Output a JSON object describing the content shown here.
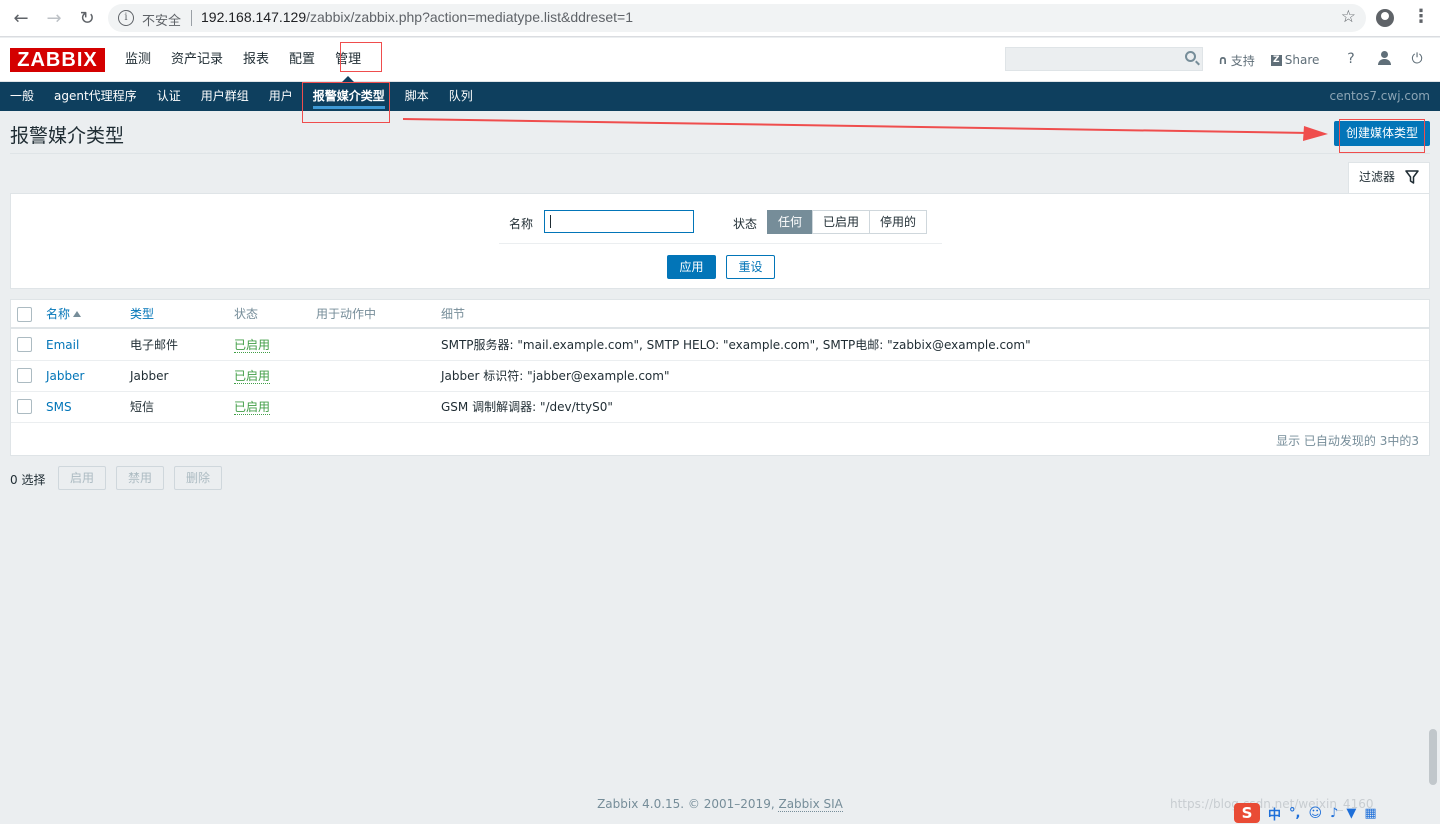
{
  "browser": {
    "insecure_label": "不安全",
    "url_host": "192.168.147.129",
    "url_path": "/zabbix/zabbix.php?action=mediatype.list&ddreset=1"
  },
  "app": {
    "logo": "ZABBIX",
    "main_menu": [
      "监测",
      "资产记录",
      "报表",
      "配置",
      "管理"
    ],
    "active_main": "管理",
    "top_links": {
      "support": "支持",
      "share": "Share",
      "help": "?"
    },
    "sub_menu": [
      "一般",
      "agent代理程序",
      "认证",
      "用户群组",
      "用户",
      "报警媒介类型",
      "脚本",
      "队列"
    ],
    "active_sub": "报警媒介类型",
    "hostname": "centos7.cwj.com"
  },
  "page": {
    "title": "报警媒介类型",
    "create_button": "创建媒体类型"
  },
  "filter": {
    "tab_label": "过滤器",
    "name_label": "名称",
    "name_value": "",
    "status_label": "状态",
    "status_options": [
      "任何",
      "已启用",
      "停用的"
    ],
    "status_selected": "任何",
    "apply": "应用",
    "reset": "重设"
  },
  "table": {
    "headers": {
      "name": "名称",
      "type": "类型",
      "status": "状态",
      "used_in": "用于动作中",
      "details": "细节"
    },
    "rows": [
      {
        "name": "Email",
        "type": "电子邮件",
        "status": "已启用",
        "used_in": "",
        "details": "SMTP服务器: \"mail.example.com\", SMTP HELO: \"example.com\", SMTP电邮: \"zabbix@example.com\""
      },
      {
        "name": "Jabber",
        "type": "Jabber",
        "status": "已启用",
        "used_in": "",
        "details": "Jabber 标识符: \"jabber@example.com\""
      },
      {
        "name": "SMS",
        "type": "短信",
        "status": "已启用",
        "used_in": "",
        "details": "GSM 调制解调器: \"/dev/ttyS0\""
      }
    ],
    "footer": "显示 已自动发现的 3中的3"
  },
  "actions": {
    "selected": "0 选择",
    "enable": "启用",
    "disable": "禁用",
    "delete": "删除"
  },
  "footer": {
    "copyright": "Zabbix 4.0.15. © 2001–2019,",
    "company": "Zabbix SIA",
    "watermark": "https://blog.csdn.net/weixin_4160"
  },
  "ime": {
    "logo": "S",
    "lang": "中"
  },
  "colors": {
    "accent": "#0275b8",
    "nav": "#0e3f5e",
    "logo": "#d40000",
    "enabled": "#429e47",
    "annotation": "#ef4d4d"
  }
}
